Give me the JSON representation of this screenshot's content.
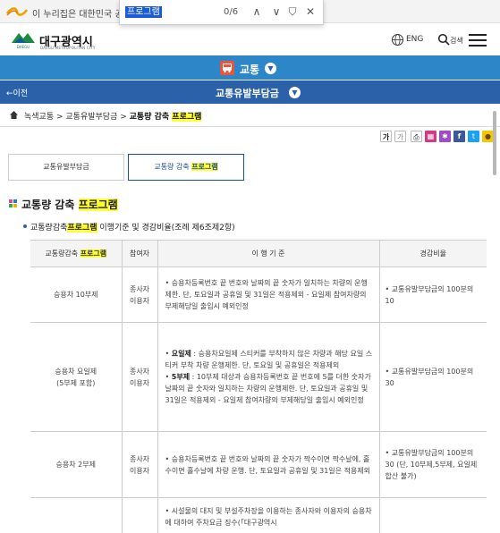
{
  "gov_banner": {
    "text": "이 누리집은 대한민국 공식"
  },
  "find": {
    "query": "프로그램",
    "count": "0/6"
  },
  "header": {
    "logo_ko": "대구광역시",
    "logo_en": "DAEGU METROPOLITAN CITY",
    "lang": "ENG",
    "search": "검색"
  },
  "nav1": {
    "title": "교통"
  },
  "nav2": {
    "back": "이전",
    "title": "교통유발부담금"
  },
  "breadcrumb": {
    "items": [
      "녹색교통",
      "교통유발부담금",
      "교통량 감축 "
    ],
    "highlight": "프로그램"
  },
  "share": {
    "zoom_in": "가",
    "zoom_out": "가"
  },
  "tabs": [
    {
      "label": "교통유발부담금"
    },
    {
      "label": "교통량 감축 ",
      "highlight": "프로그램"
    }
  ],
  "section": {
    "title": "교통량 감축 ",
    "title_hl": "프로그램",
    "subtitle_pre": "교통량감축",
    "subtitle_hl": "프로그램",
    "subtitle_post": " 이행기준 및 경감비율(조례 제6조제2항)"
  },
  "table": {
    "headers": {
      "program_pre": "교통량감축 ",
      "program_hl": "프로그램",
      "participant": "참여자",
      "criteria": "이 행 기 준",
      "rate": "경감비율"
    },
    "rows": [
      {
        "program": "승용차 10부제",
        "participant": "종사자\n이용자",
        "criteria": "승용차등록번호 끝 번호와 날짜의 끝 숫자가 일치하는 차량의 운행제한. 단, 토요일과 공휴일 및 31일은 적용제외 - 요일제 참여차량의 부제해당일 출입시 예외인정",
        "rate": "교통유발부담금의 100분의 10"
      },
      {
        "program": "승용차 요일제\n(5부제 포함)",
        "participant": "종사자\n이용자",
        "criteria1_b": "요일제",
        "criteria1": " : 승용차요일제 스티커를 부착하지 않은 차량과 해당 요일 스티커 부착 차량 운행제한. 단, 토요일 및 공휴일은 적용제외",
        "criteria2_b": "5부제",
        "criteria2": " : 10부제 대상과 승용차등록번호 끝 번호에 5를 더한 숫자가 날짜의 끝 숫자와 일치하는 차량의 운행제한. 단, 토요일과 공휴일 및 31일은 적용제외 - 요일제 참여차량의 부제해당일 출입시 예외인정",
        "rate": "교통유발부담금의 100분의 30"
      },
      {
        "program": "승용차 2부제",
        "participant": "종사자\n이용자",
        "criteria": "승용차등록번호 끝 번호와 날짜의 끝 숫자가 짝수이면 짝수날에, 홀수이면 홀수날에 차량 운행. 단, 토요일과 공휴일 및 31일은 적용제외",
        "rate": "교통유발부담금의 100분의 30 (단, 10부제,5부제, 요일제 합산 불가)"
      },
      {
        "program": "",
        "participant": "",
        "criteria": "시설물의 대지 및 부설주차장을 이용하는 종사자와 이용자의 승용차에 대하여 주차요금 징수(「대구광역시",
        "rate": ""
      }
    ]
  },
  "colors": {
    "nav1": "#2d86c8",
    "nav2": "#2b61a9",
    "highlight": "#ffff33",
    "facebook": "#3b5998",
    "twitter": "#1da1f2"
  }
}
